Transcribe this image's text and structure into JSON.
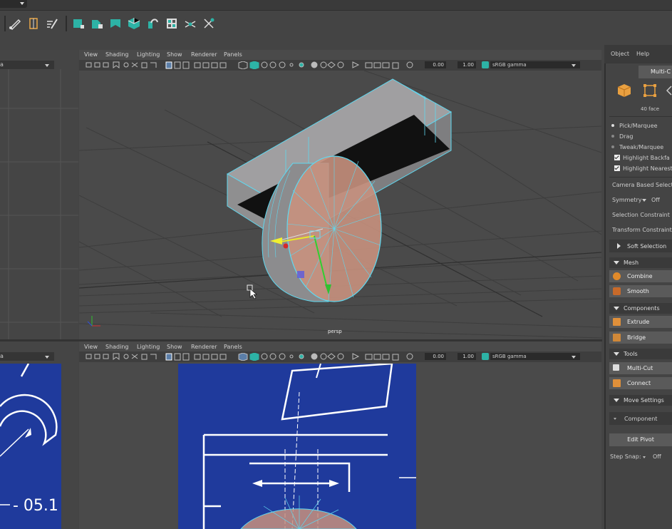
{
  "viewport_top": {
    "menu": [
      "View",
      "Shading",
      "Lighting",
      "Show",
      "Renderer",
      "Panels"
    ],
    "exposure": "0.00",
    "gamma": "1.00",
    "colorspace": "sRGB gamma",
    "camera_label": "persp"
  },
  "viewport_bottom": {
    "menu": [
      "View",
      "Shading",
      "Lighting",
      "Show",
      "Renderer",
      "Panels"
    ],
    "exposure": "0.00",
    "gamma": "1.00",
    "colorspace": "sRGB gamma"
  },
  "left_panel": {
    "field_value": "a",
    "bottom_field_value": "a",
    "drawing_text": "- 05.1"
  },
  "right_panel": {
    "menu": [
      "Object",
      "Help"
    ],
    "tab_label": "Multi-C",
    "face_count": "40 face",
    "pick_marquee": "Pick/Marquee",
    "drag": "Drag",
    "tweak_marquee": "Tweak/Marquee",
    "highlight_backfaces": "Highlight Backfa",
    "highlight_nearest": "Highlight Nearest",
    "camera_based_selection": "Camera Based Selectio",
    "symmetry_label": "Symmetry",
    "symmetry_value": "Off",
    "selection_constraint": "Selection Constraint",
    "transform_constraint": "Transform Constraint",
    "soft_selection": "Soft Selection",
    "sections": {
      "mesh": "Mesh",
      "components": "Components",
      "tools": "Tools",
      "move_settings": "Move Settings"
    },
    "tools": {
      "combine": "Combine",
      "smooth": "Smooth",
      "extrude": "Extrude",
      "bridge": "Bridge",
      "multi_cut": "Multi-Cut",
      "connect": "Connect"
    },
    "component_label": "Component",
    "edit_pivot": "Edit Pivot",
    "step_snap_label": "Step Snap:",
    "step_snap_value": "Off"
  },
  "colors": {
    "accent_teal": "#2db3a6",
    "mesh_wire": "#5fd8f0",
    "face_select": "#c8917e",
    "blueprint": "#1f3a9c"
  }
}
